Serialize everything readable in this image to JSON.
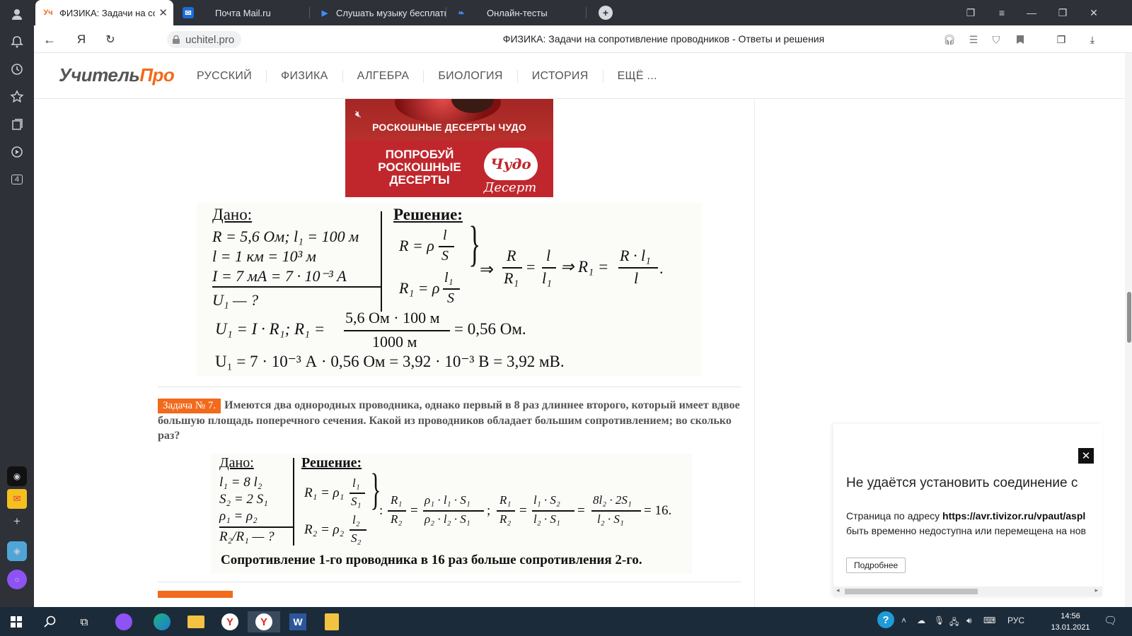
{
  "browser": {
    "tabs": [
      {
        "label": "ФИЗИКА: Задачи на сопро",
        "favicon": "Уч",
        "active": true
      },
      {
        "label": "Почта Mail.ru",
        "favicon": "mail-icon"
      },
      {
        "label": "Слушать музыку бесплатн",
        "favicon": "play-icon"
      },
      {
        "label": "Онлайн-тесты",
        "favicon": "test-icon"
      }
    ],
    "url": "uchitel.pro",
    "page_heading": "ФИЗИКА: Задачи на сопротивление проводников - Ответы и решения",
    "sidebar_badge": "4",
    "ya_icon": "Я"
  },
  "site": {
    "logo_part1": "Учитель",
    "logo_part2": "Про",
    "menu": [
      "РУССКИЙ",
      "ФИЗИКА",
      "АЛГЕБРА",
      "БИОЛОГИЯ",
      "ИСТОРИЯ",
      "ЕЩЁ ..."
    ]
  },
  "ad": {
    "line1": "РОСКОШНЫЕ ДЕСЕРТЫ ЧУДО",
    "line2": "ПОПРОБУЙ\nРОСКОШНЫЕ\nДЕСЕРТЫ",
    "brand": "Чудо",
    "brand_sub": "Десерт"
  },
  "solution1": {
    "given_title": "Дано:",
    "solution_title": "Решение:",
    "given": [
      "R = 5,6 Ом; l₁ = 100 м",
      "l = 1 км = 10³ м",
      "I = 7 мА = 7 · 10⁻³ А",
      "U₁ — ?"
    ],
    "sys1_lhs": "R = ρ",
    "sys1_num": "l",
    "sys1_den": "S",
    "sys2_lhs": "R₁ = ρ",
    "sys2_num": "l₁",
    "sys2_den": "S",
    "arrow1": "⇒",
    "frac1_num": "R",
    "frac1_den": "R₁",
    "eq": "=",
    "frac2_num": "l",
    "frac2_den": "l₁",
    "arrow2": "⇒ R₁ =",
    "frac3_num": "R · l₁",
    "frac3_den": "l",
    "line3_left": "U₁ = I · R₁;  R₁ =",
    "line3_num": "5,6 Ом · 100 м",
    "line3_den": "1000 м",
    "line3_right": "= 0,56 Ом.",
    "line4": "U₁ = 7 · 10⁻³ А · 0,56 Ом = 3,92 · 10⁻³ В = 3,92 мВ."
  },
  "task7": {
    "badge": "Задача № 7.",
    "text": "Имеются два однородных проводника, однако первый в 8 раз длиннее второго, который имеет вдвое большую площадь поперечного сечения. Какой из проводников обладает большим сопротивлением; во сколько раз?"
  },
  "solution2": {
    "given_title": "Дано:",
    "solution_title": "Решение:",
    "given": [
      "l₁ = 8 l₂",
      "S₂ = 2 S₁",
      "ρ₁ = ρ₂",
      "R₂/R₁ — ?"
    ],
    "sys1_lhs": "R₁ = ρ₁",
    "sys1_num": "l₁",
    "sys1_den": "S₁",
    "sys2_lhs": "R₂ = ρ₂",
    "sys2_num": "l₂",
    "sys2_den": "S₂",
    "colon": ":",
    "f1_num": "R₁",
    "f1_den": "R₂",
    "f2_num": "ρ₁ · l₁ · S₁",
    "f2_den": "ρ₂ · l₂ · S₁",
    "semicolon": ";",
    "f3_num": "R₁",
    "f3_den": "R₂",
    "f4_num": "l₁ · S₂",
    "f4_den": "l₂ · S₁",
    "f5_num": "8l₂ · 2S₁",
    "f5_den": "l₂ · S₁",
    "result": "= 16.",
    "conclusion": "Сопротивление 1-го проводника в 16 раз больше сопротивления 2-го."
  },
  "error_popup": {
    "title": "Не удаётся установить соединение с",
    "body_prefix": "Страница по адресу ",
    "body_url": "https://avr.tivizor.ru/vpaut/aspl",
    "body_line2": "быть временно недоступна или перемещена на нов",
    "button": "Подробнее"
  },
  "taskbar": {
    "lang": "РУС",
    "time": "14:56",
    "date": "13.01.2021"
  }
}
